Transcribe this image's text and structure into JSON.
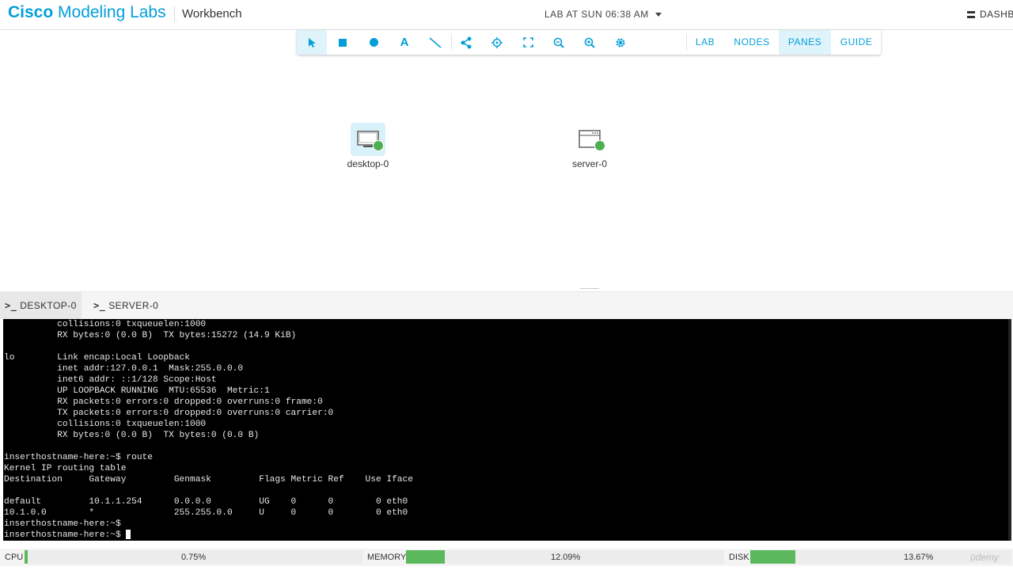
{
  "header": {
    "brand_bold": "Cisco",
    "brand_rest": " Modeling Labs",
    "section": "Workbench",
    "lab_title": "LAB AT SUN 06:38 AM",
    "dashboard": "DASHB"
  },
  "toolbar": {
    "tools": [
      "pointer-icon",
      "rectangle-icon",
      "circle-icon",
      "text-icon",
      "line-icon",
      "share-icon",
      "crosshair-icon",
      "fit-screen-icon",
      "zoom-out-icon",
      "zoom-in-icon",
      "gear-icon"
    ],
    "menus": [
      "LAB",
      "NODES",
      "PANES",
      "GUIDE"
    ],
    "active_menu": "PANES"
  },
  "nodes": [
    {
      "label": "desktop-0",
      "status": "running",
      "icon": "desktop-icon",
      "selected": true
    },
    {
      "label": "server-0",
      "status": "running",
      "icon": "server-icon",
      "selected": false
    }
  ],
  "tabs": [
    "DESKTOP-0",
    "SERVER-0"
  ],
  "active_tab": "DESKTOP-0",
  "terminal": {
    "lines": [
      "          collisions:0 txqueuelen:1000",
      "          RX bytes:0 (0.0 B)  TX bytes:15272 (14.9 KiB)",
      "",
      "lo        Link encap:Local Loopback",
      "          inet addr:127.0.0.1  Mask:255.0.0.0",
      "          inet6 addr: ::1/128 Scope:Host",
      "          UP LOOPBACK RUNNING  MTU:65536  Metric:1",
      "          RX packets:0 errors:0 dropped:0 overruns:0 frame:0",
      "          TX packets:0 errors:0 dropped:0 overruns:0 carrier:0",
      "          collisions:0 txqueuelen:1000",
      "          RX bytes:0 (0.0 B)  TX bytes:0 (0.0 B)",
      "",
      "inserthostname-here:~$ route",
      "Kernel IP routing table",
      "Destination     Gateway         Genmask         Flags Metric Ref    Use Iface",
      "",
      "default         10.1.1.254      0.0.0.0         UG    0      0        0 eth0",
      "10.1.0.0        *               255.255.0.0     U     0      0        0 eth0",
      "inserthostname-here:~$",
      "inserthostname-here:~$ "
    ]
  },
  "status": {
    "cpu_label": "CPU",
    "cpu_value": "0.75%",
    "cpu_fraction": 0.0075,
    "mem_label": "MEMORY",
    "mem_value": "12.09%",
    "mem_fraction": 0.1209,
    "disk_label": "DISK",
    "disk_value": "13.67%",
    "disk_fraction": 0.1367
  },
  "colors": {
    "accent": "#049fd9",
    "ok": "#4caf50",
    "bar": "#5cb85c"
  },
  "watermark": "ūdemy"
}
